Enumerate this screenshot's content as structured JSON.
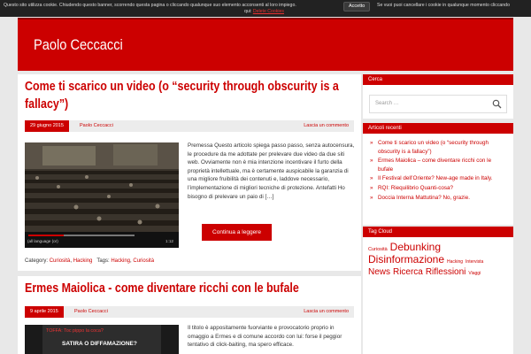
{
  "cookie": {
    "text1": "Questo sito utilizza cookie. Chiudendo questo banner, scorrendo questa pagina o cliccando qualunque suo elemento acconsenti al loro impiego.",
    "accept_label": "Accetto",
    "text2": "Se vuoi puoi cancellare i cookie in qualunque momento cliccando",
    "text3_prefix": "qui:",
    "delete_link": "Delete Cookies"
  },
  "site": {
    "title": "Paolo Ceccacci"
  },
  "posts": [
    {
      "title": "Come ti scarico un video (o “security through obscurity is a fallacy”)",
      "date": "29 giugno 2015",
      "author": "Paolo Ceccacci",
      "comment": "Lascia un commento",
      "video_caption": "(all language (or)",
      "video_time": "1:12",
      "excerpt": "Premessa Questo articolo spiega passo passo, senza autocensura, le procedure da me adottate per prelevare due video da due siti web. Ovviamente non è mia intenzione incentivare il furto della proprietà intellettuale, ma è certamente auspicabile la garanzia di una migliore fruibilità dei contenuti e, laddove necessario, l’implementazione di migliori tecniche di protezione. Antefatti Ho bisogno di prelevare un paio di […]",
      "read_more": "Continua a leggere",
      "category_label": "Category:",
      "categories": [
        "Curiosità",
        "Hacking"
      ],
      "tags_label": "Tags:",
      "tags": [
        "Hacking",
        "Curiosità"
      ]
    },
    {
      "title": "Ermes Maiolica - come diventare ricchi con le bufale",
      "date": "9 aprile 2015",
      "author": "Paolo Ceccacci",
      "comment": "Lascia un commento",
      "thumb_caption_1": "TOFFA: Toc pippo la coca?",
      "thumb_caption_2": "SATIRA O DIFFAMAZIONE?",
      "excerpt": "Il titolo è appositamente fuorviante e provocatorio proprio in omaggio a Ermes e di comune accordo con lui: forse il peggior tentativo di click-baiting, ma spero efficace."
    }
  ],
  "sidebar": {
    "search": {
      "title": "Cerca",
      "placeholder": "Search …"
    },
    "recent": {
      "title": "Articoli recenti",
      "items": [
        "Come ti scarico un video (o “security through obscurity is a fallacy”)",
        "Ermes Maiolica – come diventare ricchi con le bufale",
        "Il Festival dell’Oriente? New-age made in Italy.",
        "RQI: Riequilibrio Quanti-cosa?",
        "Doccia Interna Mattutina? No, grazie."
      ]
    },
    "tags": {
      "title": "Tag Cloud",
      "items": [
        {
          "label": "Curiosità",
          "size": 5.5
        },
        {
          "label": "Debunking",
          "size": 12
        },
        {
          "label": "Disinformazione",
          "size": 12
        },
        {
          "label": "Hacking",
          "size": 5
        },
        {
          "label": "Intervista",
          "size": 5
        },
        {
          "label": "News",
          "size": 10
        },
        {
          "label": "Ricerca",
          "size": 10
        },
        {
          "label": "Riflessioni",
          "size": 10
        },
        {
          "label": "Viaggi",
          "size": 5
        }
      ]
    }
  },
  "colors": {
    "accent": "#cc0000",
    "cookie_bar": "#222222",
    "background": "#e8e8e8"
  }
}
